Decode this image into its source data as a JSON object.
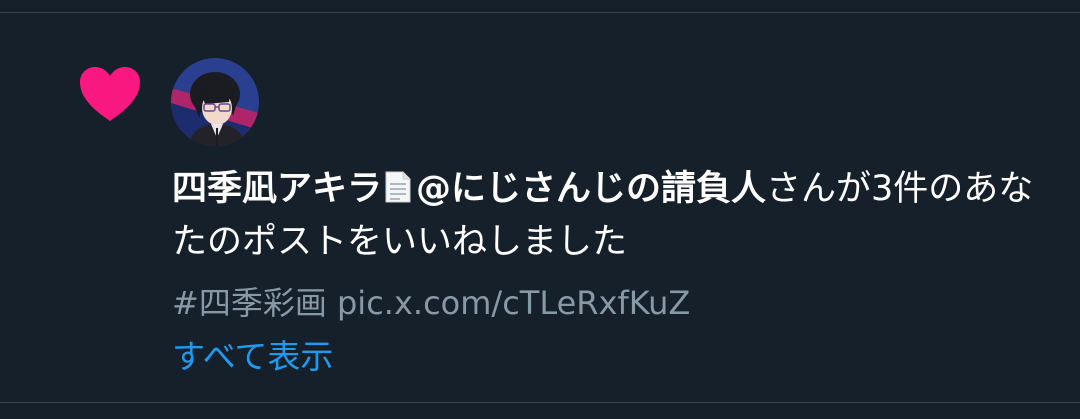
{
  "notification": {
    "type_icon": "heart-icon",
    "accent_color": "#f91880",
    "avatar_icon": "user-avatar",
    "user": {
      "display_name": "四季凪アキラ",
      "badge_icon": "page-facing-up-icon",
      "handle": "@にじさんじの請負人"
    },
    "action_text": "さんが3件のあなたのポストをいいねしました",
    "post_text": "#四季彩画 pic.x.com/cTLeRxfKuZ",
    "show_all_label": "すべて表示"
  },
  "colors": {
    "background": "#15202b",
    "divider": "#38444d",
    "primary_text": "#ffffff",
    "secondary_text": "#8899a6",
    "link": "#1d9bf0",
    "like": "#f91880"
  }
}
